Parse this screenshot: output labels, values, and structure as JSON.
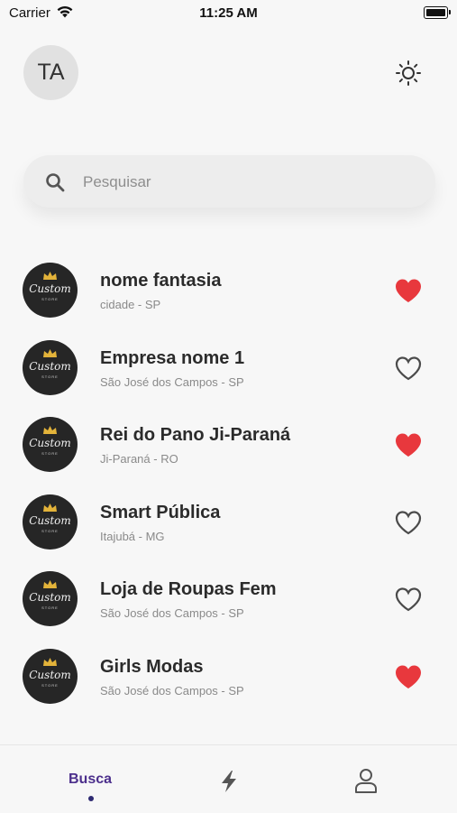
{
  "status_bar": {
    "carrier": "Carrier",
    "time": "11:25 AM"
  },
  "header": {
    "avatar_initials": "TA",
    "theme_icon": "sun-icon"
  },
  "search": {
    "placeholder": "Pesquisar",
    "value": ""
  },
  "stores": [
    {
      "name": "nome fantasia",
      "location": "cidade - SP",
      "favorite": true,
      "logo_text": "Custom",
      "logo_subtext": "STORE"
    },
    {
      "name": "Empresa nome 1",
      "location": "São José dos Campos - SP",
      "favorite": false,
      "logo_text": "Custom",
      "logo_subtext": "STORE"
    },
    {
      "name": "Rei do Pano Ji-Paraná",
      "location": "Ji-Paraná - RO",
      "favorite": true,
      "logo_text": "Custom",
      "logo_subtext": "STORE"
    },
    {
      "name": "Smart Pública",
      "location": "Itajubá - MG",
      "favorite": false,
      "logo_text": "Custom",
      "logo_subtext": "STORE"
    },
    {
      "name": "Loja de Roupas Fem",
      "location": "São José dos Campos - SP",
      "favorite": false,
      "logo_text": "Custom",
      "logo_subtext": "STORE"
    },
    {
      "name": "Girls Modas",
      "location": "São José dos Campos - SP",
      "favorite": true,
      "logo_text": "Custom",
      "logo_subtext": "STORE"
    }
  ],
  "tabbar": {
    "busca_label": "Busca",
    "tabs": [
      "Busca",
      "flash-icon",
      "profile-icon"
    ],
    "active_tab": "Busca"
  },
  "colors": {
    "heart_active": "#e8383d",
    "heart_inactive": "#4a4a4a",
    "tab_active": "#4c2f8c",
    "background": "#f7f7f7"
  }
}
